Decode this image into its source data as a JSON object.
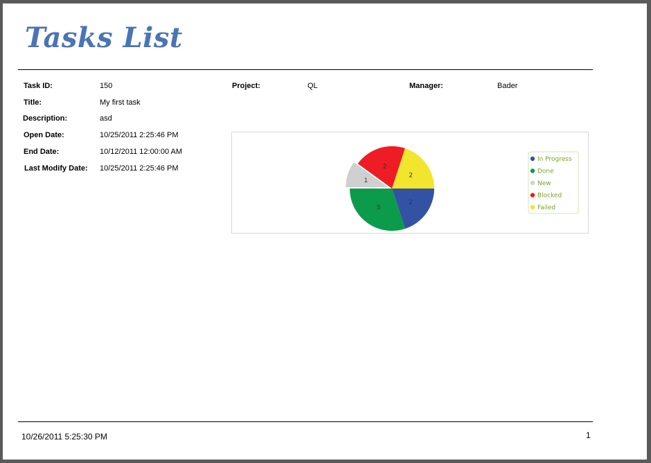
{
  "report": {
    "title": "Tasks List",
    "fields": {
      "task_id": {
        "label": "Task ID:",
        "value": "150"
      },
      "title": {
        "label": "Title:",
        "value": "My first task"
      },
      "description": {
        "label": "Description:",
        "value": "asd"
      },
      "open_date": {
        "label": "Open Date:",
        "value": "10/25/2011 2:25:46 PM"
      },
      "end_date": {
        "label": "End Date:",
        "value": "10/12/2011 12:00:00 AM"
      },
      "last_modify_date": {
        "label": "Last Modify Date:",
        "value": "10/25/2011 2:25:46 PM"
      },
      "project": {
        "label": "Project:",
        "value": "QL"
      },
      "manager": {
        "label": "Manager:",
        "value": "Bader"
      }
    }
  },
  "chart_data": {
    "type": "pie",
    "title": "",
    "categories": [
      "In Progress",
      "Done",
      "New",
      "Blocked",
      "Failed"
    ],
    "values": [
      2,
      3,
      1,
      2,
      2
    ],
    "colors": [
      "#3452a4",
      "#0b9b4a",
      "#d0d0d0",
      "#ee1c24",
      "#f2e52e"
    ],
    "exploded": "New",
    "legend_position": "right",
    "legend_text_color": "#7aa02c"
  },
  "footer": {
    "printed_at": "10/26/2011 5:25:30 PM",
    "page_number": "1"
  }
}
